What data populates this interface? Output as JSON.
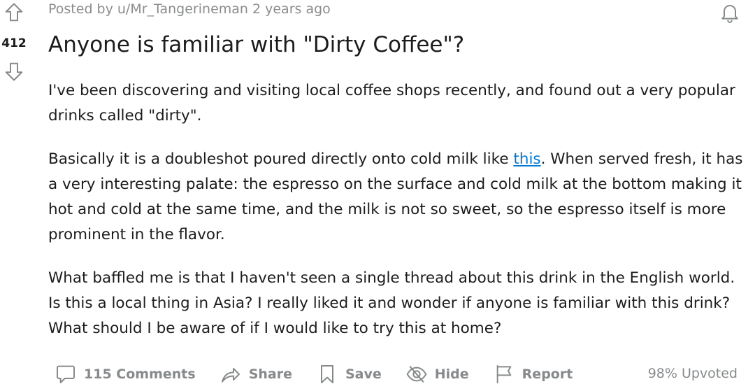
{
  "post": {
    "byline": "Posted by u/Mr_Tangerineman 2 years ago",
    "score": "412",
    "title": "Anyone is familiar with \"Dirty Coffee\"?",
    "body": {
      "p1": "I've been discovering and visiting local coffee shops recently, and found out a very popular drinks called \"dirty\".",
      "p2_before_link": "Basically it is a doubleshot poured directly onto cold milk like ",
      "p2_link": "this",
      "p2_after_link": ". When served fresh, it has a very interesting palate: the espresso on the surface and cold milk at the bottom making it hot and cold at the same time, and the milk is not so sweet, so the espresso itself is more prominent in the flavor.",
      "p3": "What baffled me is that I haven't seen a single thread about this drink in the English world. Is this a local thing in Asia? I really liked it and wonder if anyone is familiar with this drink? What should I be aware of if I would like to try this at home?"
    },
    "actions": {
      "comments": "115 Comments",
      "share": "Share",
      "save": "Save",
      "hide": "Hide",
      "report": "Report"
    },
    "upvoted": "98% Upvoted"
  },
  "icons": {
    "upvote": "upvote-arrow-icon",
    "downvote": "downvote-arrow-icon",
    "bell": "bell-icon",
    "comment": "comment-bubble-icon",
    "share": "share-arrow-icon",
    "save": "bookmark-icon",
    "hide": "eye-slash-icon",
    "report": "flag-icon"
  },
  "colors": {
    "link": "#0079d3",
    "muted": "#878a8c",
    "text": "#1c1c1c"
  }
}
